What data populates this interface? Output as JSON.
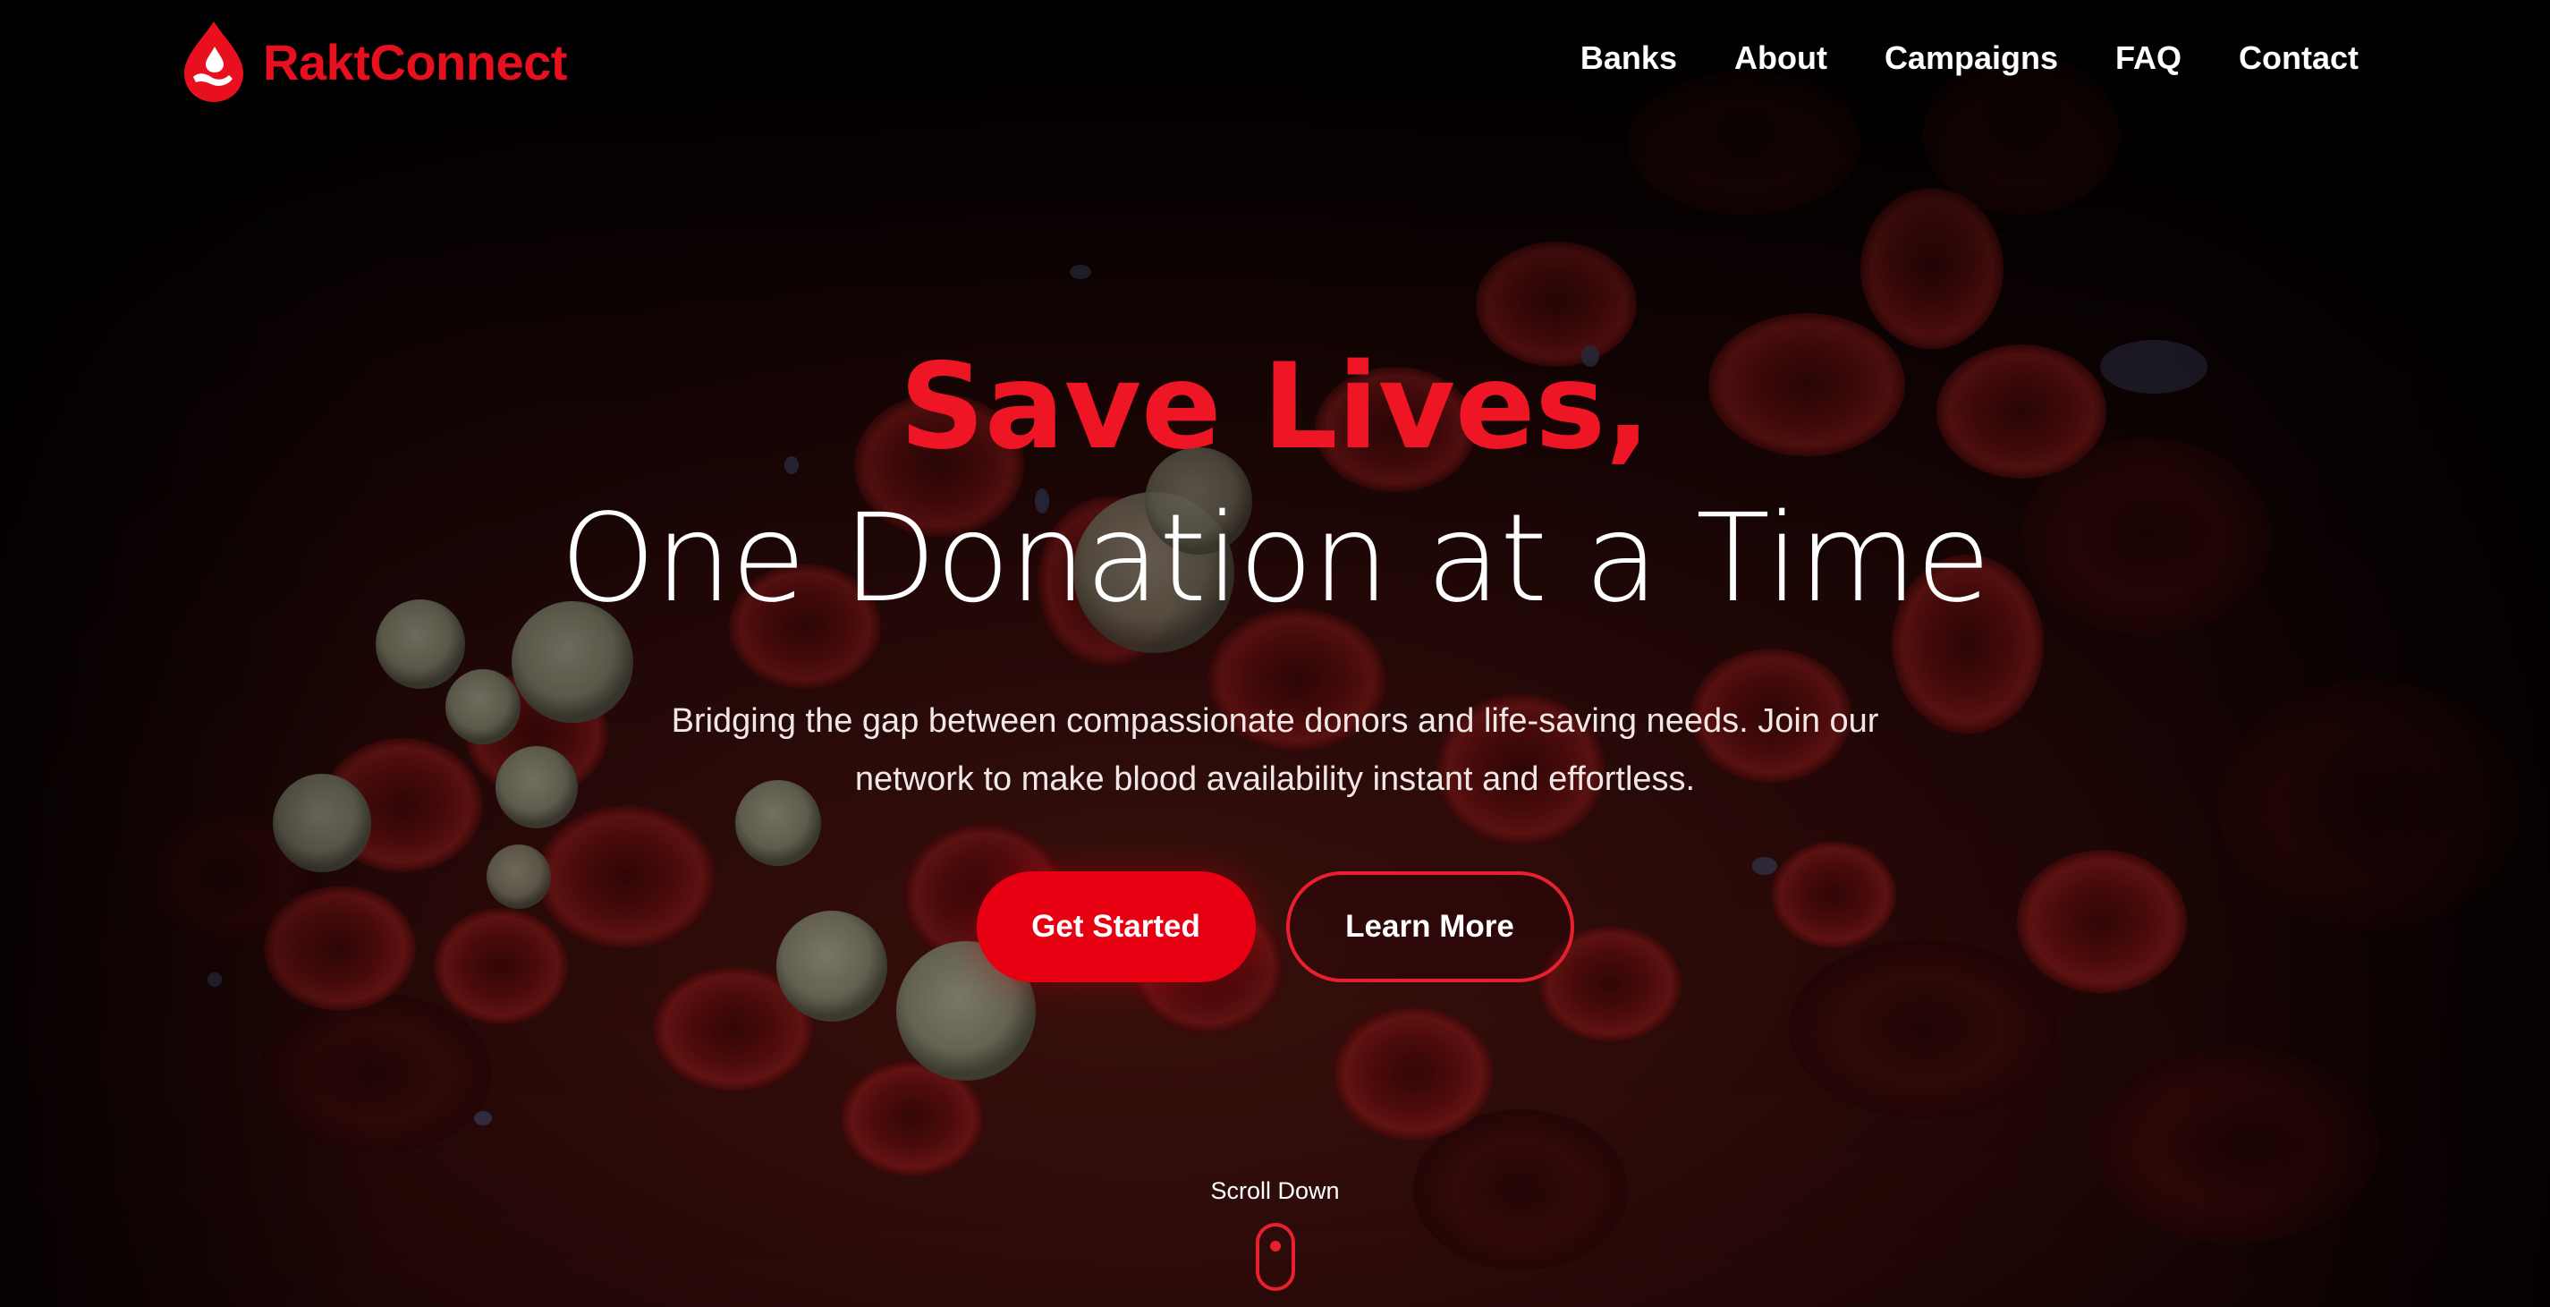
{
  "brand": {
    "name": "RaktConnect",
    "color": "#e8101e",
    "icon": "blood-drop-hand-icon"
  },
  "nav": {
    "items": [
      {
        "label": "Banks"
      },
      {
        "label": "About"
      },
      {
        "label": "Campaigns"
      },
      {
        "label": "FAQ"
      },
      {
        "label": "Contact"
      }
    ]
  },
  "hero": {
    "title_highlight": "Save Lives,",
    "title_main": "One Donation at a Time",
    "subtitle_line1": "Bridging the gap between compassionate donors and life-saving needs. Join our",
    "subtitle_line2": "network to make blood availability instant and effortless.",
    "primary_button": "Get Started",
    "secondary_button": "Learn More"
  },
  "scroll": {
    "label": "Scroll Down",
    "icon": "mouse-scroll-icon"
  },
  "colors": {
    "accent": "#e60012",
    "text": "#ffffff",
    "background": "#0a0303"
  }
}
